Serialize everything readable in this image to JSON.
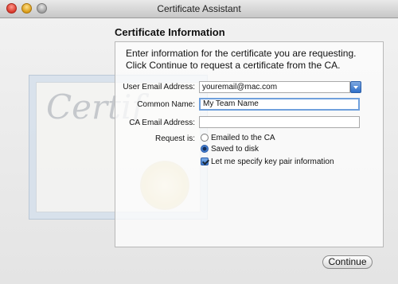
{
  "window": {
    "title": "Certificate Assistant"
  },
  "section": {
    "title": "Certificate Information",
    "intro_line1": "Enter information for the certificate you are requesting.",
    "intro_line2": "Click Continue to request a certificate from the CA."
  },
  "form": {
    "user_email_label": "User Email Address:",
    "user_email_value": "youremail@mac.com",
    "common_name_label": "Common Name:",
    "common_name_value": "My Team Name",
    "ca_email_label": "CA Email Address:",
    "ca_email_value": "",
    "request_is_label": "Request is:",
    "option_emailed": "Emailed to the CA",
    "option_saved": "Saved to disk",
    "option_keypair": "Let me specify key pair information"
  },
  "buttons": {
    "continue": "Continue"
  },
  "art": {
    "cert_word": "Certif"
  },
  "colors": {
    "focus": "#6fa0dd",
    "accent_blue": "#2f66bd"
  },
  "icons": [
    "close-icon",
    "minimize-icon",
    "zoom-icon",
    "chevron-down-icon"
  ]
}
